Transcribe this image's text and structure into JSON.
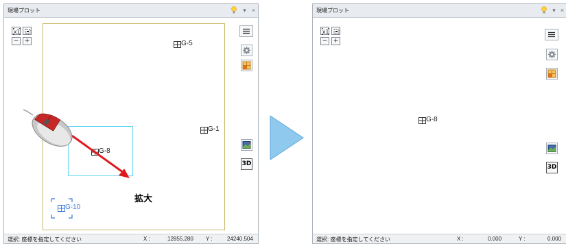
{
  "left_panel": {
    "title": "現場プロット",
    "titlebar_buttons": [
      "▾",
      "×"
    ],
    "zoom_buttons": [
      "x1",
      "fit",
      "−",
      "+"
    ],
    "points": [
      {
        "label": "G-5"
      },
      {
        "label": "G-1"
      },
      {
        "label": "G-8"
      },
      {
        "label": "G-10",
        "color": "#3a7bd5"
      }
    ],
    "annotation": "拡大",
    "status": {
      "prompt": "選択: 座標を指定してください",
      "x_label": "X :",
      "x_value": "12855.280",
      "y_label": "Y :",
      "y_value": "24240.504"
    },
    "right_tools": [
      "menu-icon",
      "gear-icon",
      "layout-icon",
      "image-view-icon",
      "3D"
    ]
  },
  "right_panel": {
    "title": "現場プロット",
    "titlebar_buttons": [
      "▾",
      "×"
    ],
    "zoom_buttons": [
      "x1",
      "fit",
      "−",
      "+"
    ],
    "points": [
      {
        "label": "G-8"
      }
    ],
    "status": {
      "prompt": "選択: 座標を指定してください",
      "x_label": "X :",
      "x_value": "0.000",
      "y_label": "Y :",
      "y_value": "0.000"
    },
    "right_tools": [
      "menu-icon",
      "gear-icon",
      "layout-icon",
      "image-view-icon",
      "3D"
    ]
  },
  "colors": {
    "frame": "#c8b464",
    "selection": "#63d4f0",
    "arrow": "#e0181c",
    "transition_arrow": "#8fc9ee",
    "highlight_point": "#3a7bd5"
  }
}
